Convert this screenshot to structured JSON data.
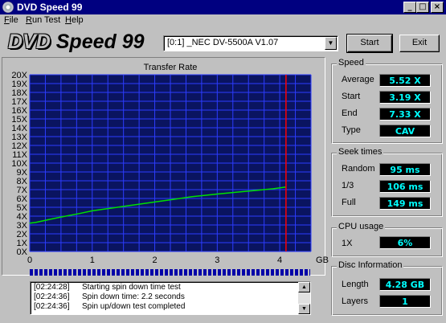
{
  "window": {
    "title": "DVD Speed 99",
    "minimize_glyph": "_",
    "maximize_glyph": "□",
    "close_glyph": "×"
  },
  "menu": [
    {
      "underline": "F",
      "rest": "ile"
    },
    {
      "underline": "R",
      "rest": "un Test"
    },
    {
      "underline": "H",
      "rest": "elp"
    }
  ],
  "toolbar": {
    "logo_dvd": "DVD",
    "logo_rest": " Speed 99",
    "drive": "[0:1]  _NEC DV-5500A V1.07",
    "start_label": "Start",
    "exit_label": "Exit"
  },
  "chart_data": {
    "type": "line",
    "title": "Transfer Rate",
    "xlabel": "GB",
    "ylabel": "",
    "xlim": [
      0,
      4.5
    ],
    "ylim": [
      0,
      20
    ],
    "x_ticks": [
      "0",
      "1",
      "2",
      "3",
      "4"
    ],
    "y_ticks": [
      "0X",
      "1X",
      "2X",
      "3X",
      "4X",
      "5X",
      "6X",
      "7X",
      "8X",
      "9X",
      "10X",
      "11X",
      "12X",
      "13X",
      "14X",
      "15X",
      "16X",
      "17X",
      "18X",
      "19X",
      "20X"
    ],
    "grid": true,
    "background": "#0a1460",
    "grid_color": "#2c3cff",
    "line_color": "#00e000",
    "marker_color": "#ff0000",
    "marker_x": 4.1,
    "series": [
      {
        "x": [
          0,
          0.1,
          0.3,
          0.5,
          0.8,
          1.0,
          1.3,
          1.6,
          2.0,
          2.3,
          2.6,
          3.0,
          3.3,
          3.6,
          3.9,
          4.1
        ],
        "values": [
          3.2,
          3.3,
          3.6,
          3.9,
          4.3,
          4.6,
          4.9,
          5.2,
          5.6,
          5.9,
          6.2,
          6.5,
          6.7,
          6.9,
          7.1,
          7.3
        ]
      }
    ]
  },
  "progress": 1.0,
  "log": [
    {
      "time": "[02:24:28]",
      "message": "Starting spin down time test"
    },
    {
      "time": "[02:24:36]",
      "message": "Spin down time: 2.2 seconds"
    },
    {
      "time": "[02:24:36]",
      "message": "Spin up/down test completed"
    }
  ],
  "speed": {
    "title": "Speed",
    "rows": [
      {
        "label": "Average",
        "value": "5.52 X"
      },
      {
        "label": "Start",
        "value": "3.19 X"
      },
      {
        "label": "End",
        "value": "7.33 X"
      },
      {
        "label": "Type",
        "value": "CAV"
      }
    ]
  },
  "seek": {
    "title": "Seek times",
    "rows": [
      {
        "label": "Random",
        "value": "95 ms"
      },
      {
        "label": "1/3",
        "value": "106 ms"
      },
      {
        "label": "Full",
        "value": "149 ms"
      }
    ]
  },
  "cpu": {
    "title": "CPU usage",
    "rows": [
      {
        "label": "1X",
        "value": "6%"
      }
    ]
  },
  "disc": {
    "title": "Disc Information",
    "rows": [
      {
        "label": "Length",
        "value": "4.28 GB"
      },
      {
        "label": "Layers",
        "value": "1"
      }
    ]
  }
}
